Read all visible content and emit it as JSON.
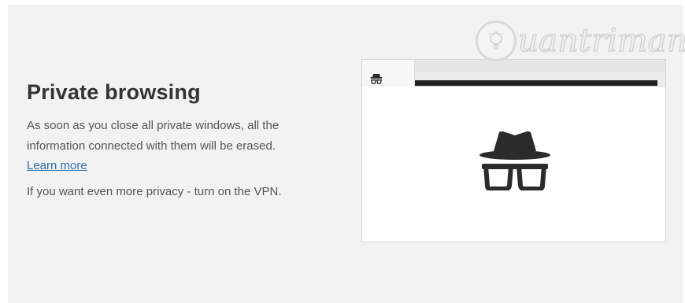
{
  "private_browsing": {
    "title": "Private browsing",
    "description": "As soon as you close all private windows, all the information connected with them will be erased.",
    "learn_more_label": "Learn more",
    "vpn_text": "If you want even more privacy - turn on the VPN."
  },
  "illustration": {
    "tab_icon": "incognito-icon",
    "main_icon": "incognito-icon"
  },
  "watermark": {
    "text": "uantrimang",
    "icon": "lightbulb-icon"
  },
  "colors": {
    "background": "#f2f2f2",
    "title": "#333333",
    "text": "#555555",
    "link": "#2b6cb0",
    "icon": "#2b2b2b"
  }
}
